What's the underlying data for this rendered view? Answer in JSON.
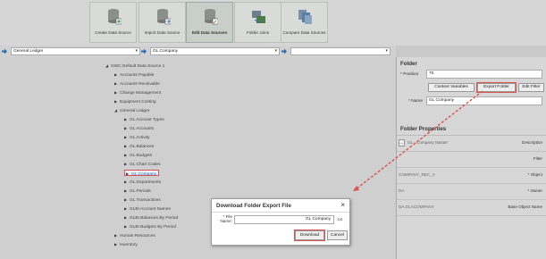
{
  "toolbar": {
    "buttons": [
      {
        "label": "Create Data Source",
        "active": false
      },
      {
        "label": "Import Data Source",
        "active": false
      },
      {
        "label": "Edit Data Sources",
        "active": true
      },
      {
        "label": "Folder Joins",
        "active": false
      },
      {
        "label": "Compare Data Sources",
        "active": false
      }
    ]
  },
  "filters": {
    "ledger_value": "General Ledger",
    "folder_value": "GL Company",
    "third_value": ""
  },
  "tree": {
    "root": "GWC Default Data Source 1",
    "items": [
      {
        "label": "Accounts Payable",
        "expanded": false
      },
      {
        "label": "Accounts Receivable",
        "expanded": false
      },
      {
        "label": "Change Management",
        "expanded": false
      },
      {
        "label": "Equipment Costing",
        "expanded": false
      },
      {
        "label": "General Ledger",
        "expanded": true
      },
      {
        "label": "GL Account Types",
        "expanded": false
      },
      {
        "label": "GL Accounts",
        "expanded": false
      },
      {
        "label": "GL Activity",
        "expanded": false
      },
      {
        "label": "GL Balances",
        "expanded": false
      },
      {
        "label": "GL Budgets",
        "expanded": false
      },
      {
        "label": "GL Chart Codes",
        "expanded": false
      },
      {
        "label": "GL Company",
        "expanded": false,
        "selected": true
      },
      {
        "label": "GL Departments",
        "expanded": false
      },
      {
        "label": "GL Periods",
        "expanded": false
      },
      {
        "label": "GL Transactions",
        "expanded": false
      },
      {
        "label": "GLBI Account Names",
        "expanded": false
      },
      {
        "label": "GLBI Balances By Period",
        "expanded": false
      },
      {
        "label": "GLBI Budgets By Period",
        "expanded": false
      },
      {
        "label": "Human Resources",
        "expanded": false
      },
      {
        "label": "Inventory",
        "expanded": false
      }
    ]
  },
  "folder_panel": {
    "title": "Folder",
    "position_label": "Position",
    "position_value": "70",
    "context_variables_label": "Context Variables",
    "export_folder_label": "Export Folder",
    "edit_filter_label": "Edit Filter",
    "name_label": "Name",
    "name_value": "GL Company"
  },
  "properties_panel": {
    "title": "Folder Properties",
    "rows": [
      {
        "value": "GL - Company Master",
        "key": "Description"
      },
      {
        "value": "",
        "key": "Filter"
      },
      {
        "value": "COMPANY_REC_V",
        "key": "Object"
      },
      {
        "value": "DA",
        "key": "Owner"
      },
      {
        "value": "DA.GLACOMPANY",
        "key": "Base Object Name"
      }
    ]
  },
  "dialog": {
    "title": "Download Folder Export File",
    "close_glyph": "×",
    "file_name_label": "File Name:",
    "file_name_value": "GL Company",
    "extension": ".txt",
    "download_label": "Download",
    "cancel_label": "Cancel"
  },
  "colors": {
    "highlight": "#d9534f",
    "selection_text": "#2a5db0"
  }
}
